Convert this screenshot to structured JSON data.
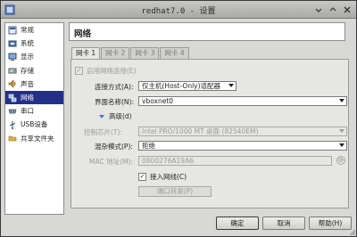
{
  "window": {
    "title": "redhat7.0 - 设置"
  },
  "sidebar": {
    "items": [
      {
        "label": "常规",
        "icon": "general-icon",
        "active": false
      },
      {
        "label": "系统",
        "icon": "system-icon",
        "active": false
      },
      {
        "label": "显示",
        "icon": "display-icon",
        "active": false
      },
      {
        "label": "存储",
        "icon": "storage-icon",
        "active": false
      },
      {
        "label": "声音",
        "icon": "audio-icon",
        "active": false
      },
      {
        "label": "网络",
        "icon": "network-icon",
        "active": true
      },
      {
        "label": "串口",
        "icon": "serial-port-icon",
        "active": false
      },
      {
        "label": "USB设备",
        "icon": "usb-icon",
        "active": false
      },
      {
        "label": "共享文件夹",
        "icon": "shared-folder-icon",
        "active": false
      }
    ]
  },
  "header": {
    "title": "网络"
  },
  "tabs": [
    {
      "label": "网卡 1",
      "active": true
    },
    {
      "label": "网卡 2",
      "active": false
    },
    {
      "label": "网卡 3",
      "active": false
    },
    {
      "label": "网卡 4",
      "active": false
    }
  ],
  "adapter": {
    "enable_label": "启用网络连接(E)",
    "enable_checked": true,
    "attached_label": "连接方式(A):",
    "attached_value": "仅主机(Host-Only)适配器",
    "name_label": "界面名称(N):",
    "name_value": "vboxnet0",
    "advanced_label": "高级(d)",
    "chip_label": "控制芯片(T):",
    "chip_value": "Intel PRO/1000 MT 桌面 (82540EM)",
    "promisc_label": "混杂模式(P):",
    "promisc_value": "拒绝",
    "mac_label": "MAC 地址(M):",
    "mac_value": "0800276A19A6",
    "cable_label": "接入网线(C)",
    "cable_checked": true,
    "port_forward_label": "端口转发(P)"
  },
  "buttons": {
    "ok": "确定",
    "cancel": "取消",
    "help": "帮助(H)"
  },
  "colors": {
    "selection": "#23308a",
    "accent": "#3b78c9"
  }
}
